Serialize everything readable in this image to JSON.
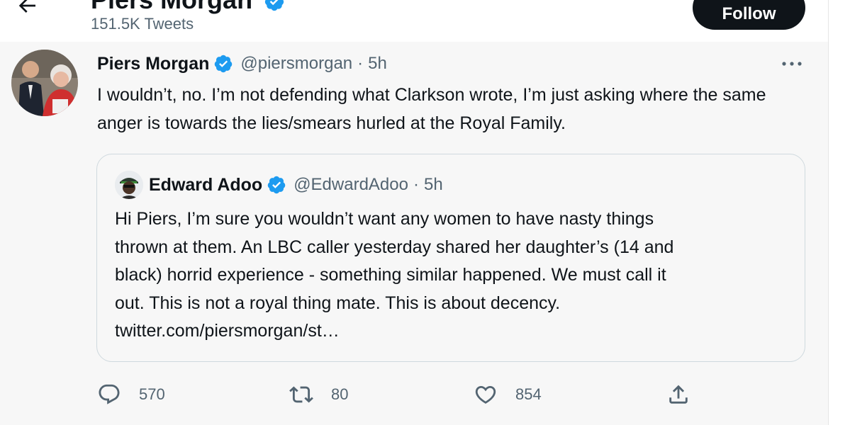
{
  "header": {
    "profile_name": "Piers Morgan",
    "tweet_count": "151.5K Tweets",
    "follow_label": "Follow"
  },
  "tweet": {
    "author_name": "Piers Morgan",
    "author_handle": "@piersmorgan",
    "separator": "·",
    "time": "5h",
    "text": "I wouldn’t, no. I’m not defending what Clarkson wrote, I’m just asking where the same anger is towards the lies/smears hurled at the Royal Family."
  },
  "quote": {
    "author_name": "Edward Adoo",
    "author_handle": "@EdwardAdoo",
    "separator": "·",
    "time": "5h",
    "lines": [
      "Hi Piers, I’m sure you wouldn’t want any women to have nasty things",
      "thrown at them. An LBC caller yesterday shared her daughter’s  (14 and",
      "black) horrid experience - something similar happened. We must call it",
      "out. This is not a royal thing mate. This is about decency.",
      "twitter.com/piersmorgan/st…"
    ]
  },
  "actions": {
    "replies": "570",
    "retweets": "80",
    "likes": "854"
  },
  "icons": {
    "back": "back-arrow-icon",
    "verified": "verified-badge-icon",
    "more": "more-icon",
    "reply": "reply-icon",
    "retweet": "retweet-icon",
    "like": "like-icon",
    "share": "share-icon"
  },
  "colors": {
    "verified_blue": "#1d9bf0",
    "text_primary": "#0f1419",
    "text_secondary": "#536471",
    "follow_bg": "#0f1419",
    "tweet_bg": "#f7f7f7"
  }
}
